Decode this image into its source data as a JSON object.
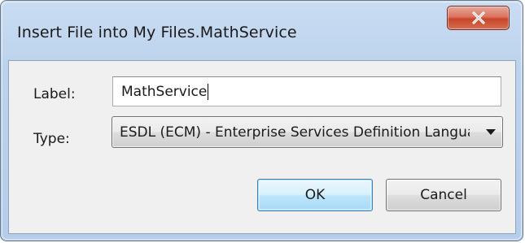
{
  "window": {
    "title": "Insert File into My Files.MathService",
    "close_icon": "close-x-icon"
  },
  "form": {
    "label_caption": "Label:",
    "label_value": "MathService",
    "type_caption": "Type:",
    "type_selected": "ESDL (ECM) - Enterprise Services Definition Language"
  },
  "buttons": {
    "ok_label": "OK",
    "cancel_label": "Cancel"
  },
  "colors": {
    "close_button": "#c8452b",
    "default_button_border": "#3c7fb1"
  }
}
